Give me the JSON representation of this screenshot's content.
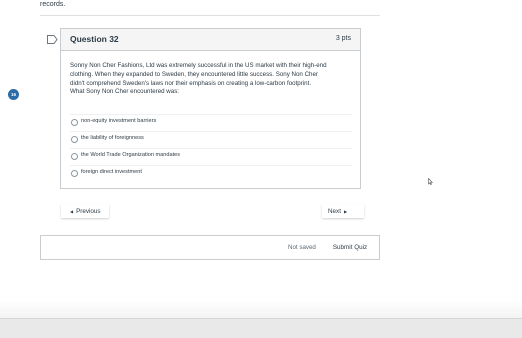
{
  "previous_content": {
    "trailing_text": "records."
  },
  "question": {
    "title": "Question 32",
    "points": "3 pts",
    "text_lines": [
      "Sonny Non Cher Fashions, Ltd was extremely successful in the US market with their high-end",
      "clothing. When they expanded to Sweden, they encountered little success. Sony Non Cher",
      "didn't comprehend Sweden's laws nor their emphasis on creating a low-carbon footprint.",
      "What Sony Non Cher encountered was:"
    ],
    "answers": [
      {
        "label": "non-equity investment barriers",
        "selected": false
      },
      {
        "label": "the liability of foreignness",
        "selected": false
      },
      {
        "label": "the World Trade Organization mandates",
        "selected": false
      },
      {
        "label": "foreign direct investment",
        "selected": false
      }
    ]
  },
  "side_badge": {
    "text": "16"
  },
  "navigation": {
    "previous_label": "Previous",
    "next_label": "Next"
  },
  "footer": {
    "status": "Not saved",
    "submit_label": "Submit Quiz"
  },
  "colors": {
    "badge": "#2b6ba8",
    "text": "#2d3b45",
    "border": "#c7cdd1",
    "header_bg": "#f5f5f5"
  },
  "icons": {
    "question_flag": "bookmark-flag-icon",
    "previous_arrow": "left-triangle-icon",
    "next_arrow": "right-triangle-icon",
    "cursor": "mouse-pointer-icon"
  }
}
